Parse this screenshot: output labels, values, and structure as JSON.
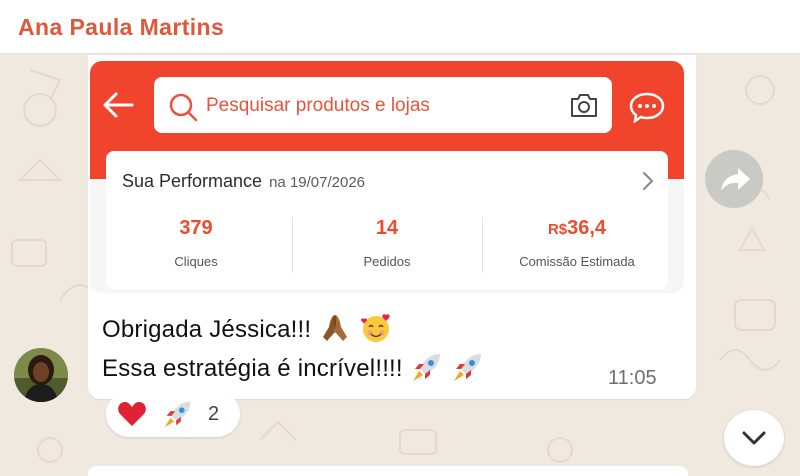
{
  "chat": {
    "sender_name": "Ana Paula Martins"
  },
  "shared_screenshot": {
    "search_placeholder": "Pesquisar produtos e lojas",
    "performance": {
      "title": "Sua Performance",
      "date_text": "na 19/07/2026",
      "stats": [
        {
          "value": "379",
          "label": "Cliques"
        },
        {
          "value": "14",
          "label": "Pedidos"
        },
        {
          "currency": "R$",
          "value": "36,4",
          "label": "Comissão Estimada"
        }
      ]
    },
    "colors": {
      "brand": "#f0452c",
      "stat_value": "#ed4a2e"
    }
  },
  "message": {
    "line1": "Obrigada Jéssica!!!",
    "line2": "Essa estratégia é incrível!!!!",
    "line1_emojis": [
      "folded-hands-emoji",
      "smiling-face-with-hearts-emoji"
    ],
    "line2_emojis": [
      "rocket-emoji",
      "rocket-emoji"
    ],
    "time": "11:05"
  },
  "reactions": {
    "emojis": [
      "red-heart-emoji",
      "rocket-emoji"
    ],
    "count": "2"
  },
  "icons": {
    "forward": "forward-arrow-icon",
    "scroll_down": "chevron-down-icon",
    "back": "back-arrow-icon",
    "search": "search-icon",
    "camera": "camera-icon",
    "chat": "chat-bubble-icon"
  },
  "colors": {
    "sender_name": "#e0573a",
    "chat_background": "#efe9df",
    "bubble": "#ffffff"
  }
}
